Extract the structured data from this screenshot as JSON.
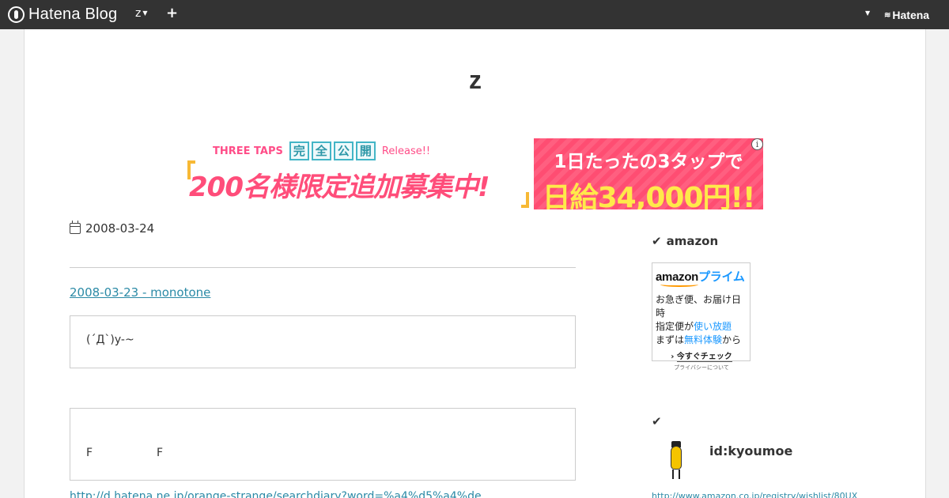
{
  "topbar": {
    "brand": "Hatena Blog",
    "blog_switch": "z",
    "plus_label": "+",
    "hatena_label": "Hatena"
  },
  "blog": {
    "title": "z"
  },
  "ad": {
    "logo": "THREE TAPS",
    "badge_chars": [
      "完",
      "全",
      "公",
      "開"
    ],
    "release": "Release!!",
    "main": "200名様限定追加募集中!",
    "right_line1": "1日たったの3タップで",
    "right_line2": "日給34,000円!!",
    "info_icon": "i"
  },
  "entry": {
    "date": "2008-03-24",
    "link_text": "2008-03-23 - monotone",
    "quote1": "(´Д`)y-~",
    "quote2_a": "F",
    "quote2_b": "F",
    "url_text": "http://d.hatena.ne.jp/orange-strange/searchdiary?word=%a4%d5%a4%de"
  },
  "sidebar": {
    "amazon_title": "amazon",
    "amazon_widget": {
      "logo_main": "amazon",
      "logo_prime": "プライム",
      "line1": "お急ぎ便、お届け日時",
      "line2_a": "指定便が",
      "line2_b": "使い放題",
      "line3_a": "まずは",
      "line3_b": "無料体験",
      "line3_c": "から",
      "cta": "今すぐチェック",
      "privacy": "プライバシーについて"
    },
    "profile": {
      "name": "id:kyoumoe",
      "url": "http://www.amazon.co.jp/registry/wishlist/80UX"
    }
  },
  "icons": {
    "check": "check-icon",
    "calendar": "calendar-icon",
    "info": "info-icon"
  },
  "colors": {
    "topbar_bg": "#333333",
    "link": "#2b8aa6",
    "ad_pink": "#ff4d72",
    "ad_yellow": "#ffe94a"
  }
}
